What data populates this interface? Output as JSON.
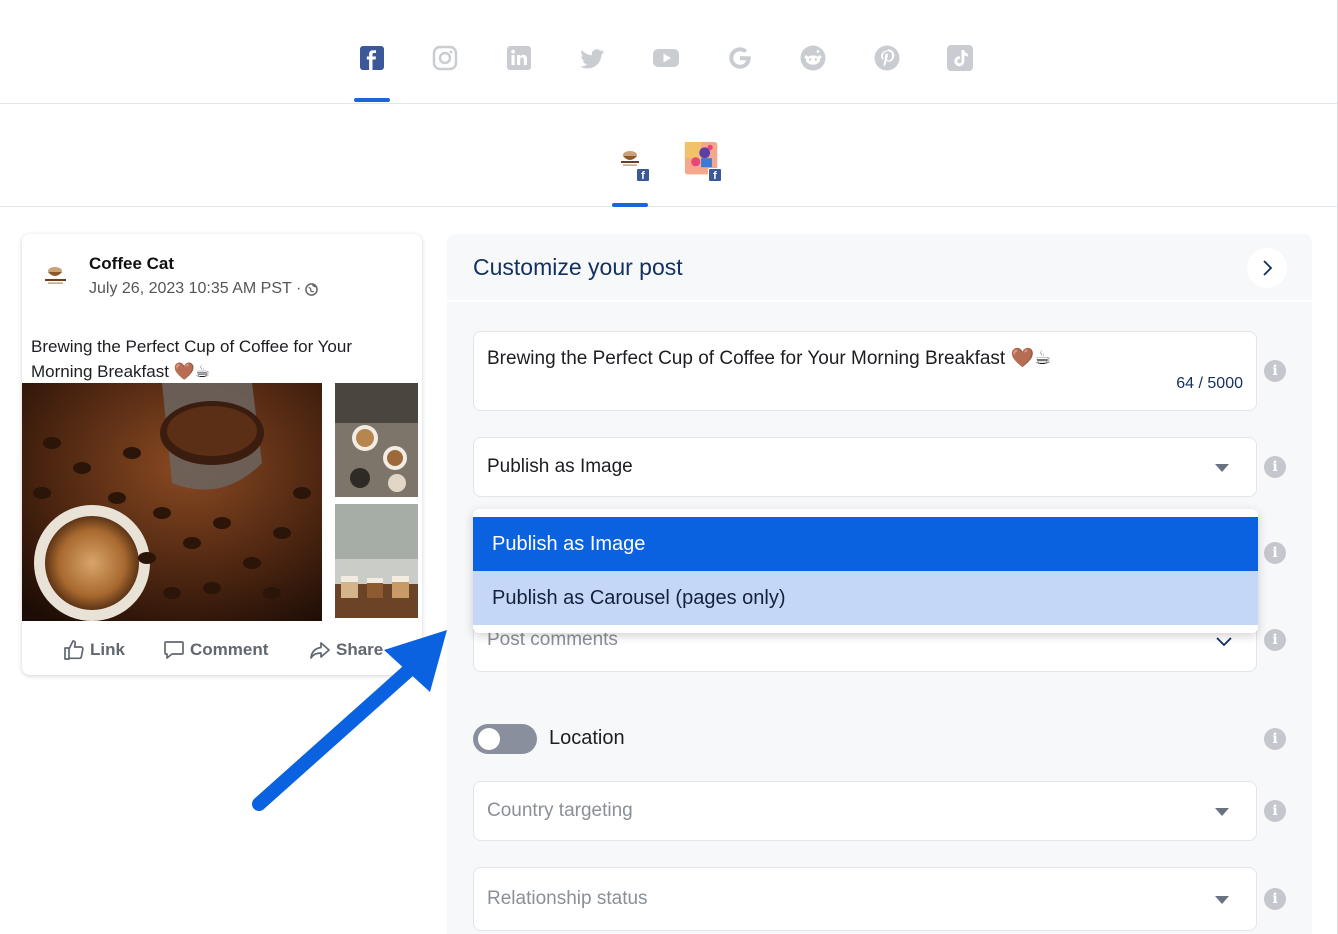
{
  "networks": [
    {
      "name": "facebook",
      "active": true
    },
    {
      "name": "instagram",
      "active": false
    },
    {
      "name": "linkedin",
      "active": false
    },
    {
      "name": "twitter",
      "active": false
    },
    {
      "name": "youtube",
      "active": false
    },
    {
      "name": "google",
      "active": false
    },
    {
      "name": "reddit",
      "active": false
    },
    {
      "name": "pinterest",
      "active": false
    },
    {
      "name": "tiktok",
      "active": false
    }
  ],
  "accounts": [
    {
      "badge": "f",
      "active": true
    },
    {
      "badge": "f",
      "active": false
    }
  ],
  "preview": {
    "page_name": "Coffee Cat",
    "date": "July 26, 2023 10:35 AM PST ·",
    "text": "Brewing the Perfect Cup of Coffee for Your Morning Breakfast 🤎☕",
    "actions": {
      "like": "Link",
      "comment": "Comment",
      "share": "Share"
    }
  },
  "panel": {
    "title": "Customize your post",
    "caption": "Brewing the Perfect Cup of Coffee for Your Morning Breakfast 🤎☕",
    "counter": "64 / 5000",
    "publish_select": "Publish as Image",
    "post_comments_placeholder": "Post comments",
    "location_label": "Location",
    "country_placeholder": "Country targeting",
    "relationship_placeholder": "Relationship status",
    "info_glyph": "i"
  },
  "dropdown": {
    "options": [
      "Publish as Image",
      "Publish as Carousel (pages only)"
    ],
    "selected": "Publish as Image"
  },
  "colors": {
    "accent": "#0a62e0",
    "facebook": "#3b5998",
    "title": "#13305e",
    "annotation_arrow": "#0a62e0"
  }
}
